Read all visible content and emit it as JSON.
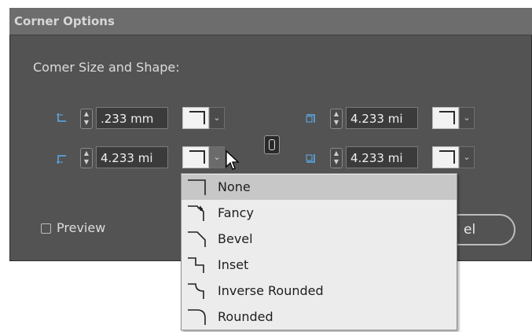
{
  "dialog": {
    "title": "Corner Options",
    "section_label": "Comer Size and Shape:",
    "corners": {
      "top_left": {
        "value": ".233 mm"
      },
      "top_right": {
        "value": "4.233 mi"
      },
      "bottom_left": {
        "value": "4.233 mi"
      },
      "bottom_right": {
        "value": "4.233 mi"
      }
    },
    "preview_label": "Preview",
    "preview_checked": false,
    "cancel_label_visible": "el"
  },
  "corner_shape_menu": {
    "items": [
      {
        "label": "None",
        "icon": "corner-none-icon"
      },
      {
        "label": "Fancy",
        "icon": "corner-fancy-icon"
      },
      {
        "label": "Bevel",
        "icon": "corner-bevel-icon"
      },
      {
        "label": "Inset",
        "icon": "corner-inset-icon"
      },
      {
        "label": "Inverse Rounded",
        "icon": "corner-inverse-rounded-icon"
      },
      {
        "label": "Rounded",
        "icon": "corner-rounded-icon"
      }
    ],
    "highlighted": "None"
  },
  "colors": {
    "dialog_bg": "#535353",
    "titlebar_bg": "#6d6d6d",
    "menu_bg": "#ececec",
    "menu_highlight": "#c7c7c7"
  }
}
